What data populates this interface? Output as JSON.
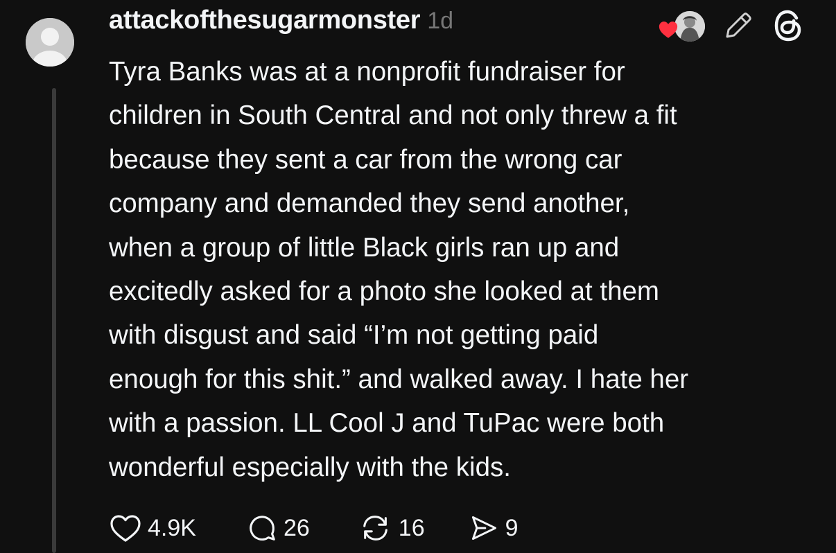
{
  "post": {
    "username": "attackofthesugarmonster",
    "time": "1d",
    "text": "Tyra Banks was at a nonprofit fundraiser for\nchildren in South Central and not only threw a fit\nbecause they sent a car from the wrong car\ncompany and demanded they send another,\nwhen a group of little Black girls ran up and\nexcitedly asked for a photo she looked at them\nwith disgust and said “I’m not getting paid\nenough for this shit.” and walked away. I hate her\nwith a passion. LL Cool J and TuPac were both\nwonderful especially with the kids."
  },
  "stats": {
    "likes": "4.9K",
    "replies": "26",
    "reposts": "16",
    "shares": "9"
  },
  "icons": {
    "avatar": "default-avatar-icon",
    "liked_by": "heart-badge-icon",
    "edit": "pencil-icon",
    "brand": "threads-logo-icon",
    "like": "heart-outline-icon",
    "reply": "speech-bubble-icon",
    "repost": "repost-arrows-icon",
    "share": "send-icon"
  },
  "colors": {
    "background": "#101010",
    "text": "#f3f5f7",
    "muted": "#777777",
    "heart": "#ff3040",
    "thread_line": "#3a3a3a"
  }
}
